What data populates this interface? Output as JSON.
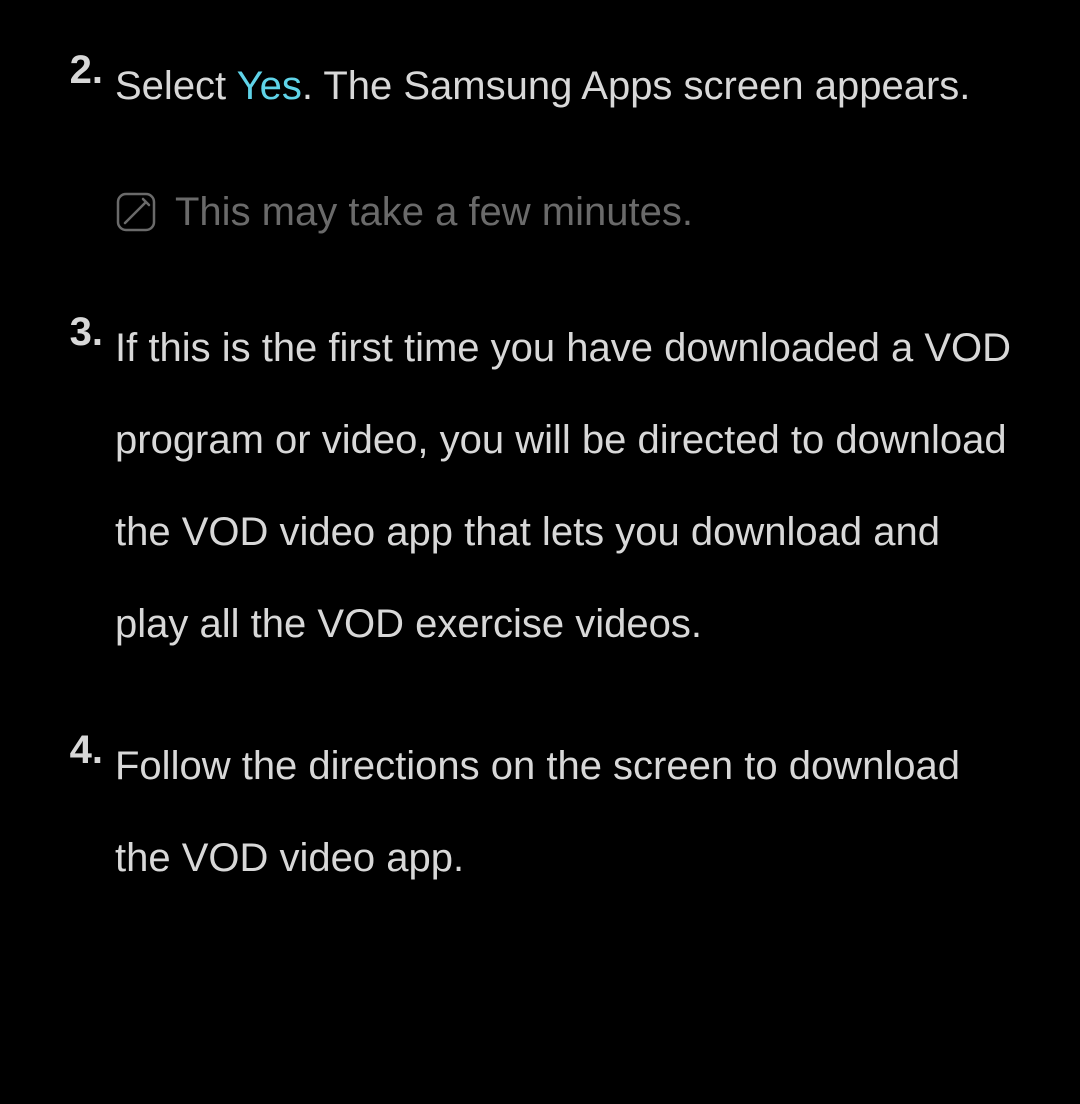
{
  "steps": {
    "step2": {
      "number": "2.",
      "text_before": "Select ",
      "highlight": "Yes",
      "text_after": ". The Samsung Apps screen appears.",
      "note": "This may take a few minutes."
    },
    "step3": {
      "number": "3.",
      "text": "If this is the first time you have downloaded a VOD program or video, you will be directed to download the VOD video app that lets you download and play all the VOD exercise videos."
    },
    "step4": {
      "number": "4.",
      "text": "Follow the directions on the screen to download the VOD video app."
    }
  }
}
